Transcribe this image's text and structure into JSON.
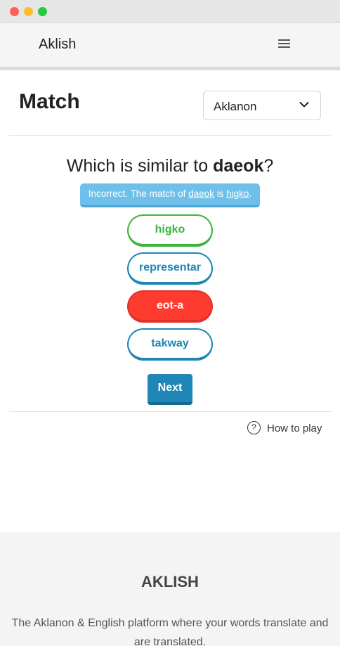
{
  "window": {
    "controls": [
      "close",
      "minimize",
      "maximize"
    ]
  },
  "navbar": {
    "brand": "Aklish",
    "menu_icon": "hamburger-icon"
  },
  "header": {
    "title": "Match",
    "language_select": {
      "value": "Aklanon",
      "icon": "chevron-down-icon"
    }
  },
  "quiz": {
    "question_prefix": "Which is similar to ",
    "question_word": "daeok",
    "question_suffix": "?",
    "feedback": {
      "prefix": "Incorrect. The match of ",
      "word": "daeok",
      "middle": " is ",
      "answer": "higko",
      "suffix": "."
    },
    "choices": [
      {
        "label": "higko",
        "state": "correct"
      },
      {
        "label": "representar",
        "state": "default"
      },
      {
        "label": "eot-a",
        "state": "wrong"
      },
      {
        "label": "takway",
        "state": "default"
      }
    ],
    "next_label": "Next"
  },
  "help": {
    "icon": "question-circle-icon",
    "label": "How to play"
  },
  "footer": {
    "title": "AKLISH",
    "description": "The Aklanon & English platform where your words translate and are translated."
  },
  "colors": {
    "primary": "#1f86b5",
    "correct": "#3cb53c",
    "wrong": "#ff3b30",
    "feedback_bg": "#6ec0ea"
  }
}
